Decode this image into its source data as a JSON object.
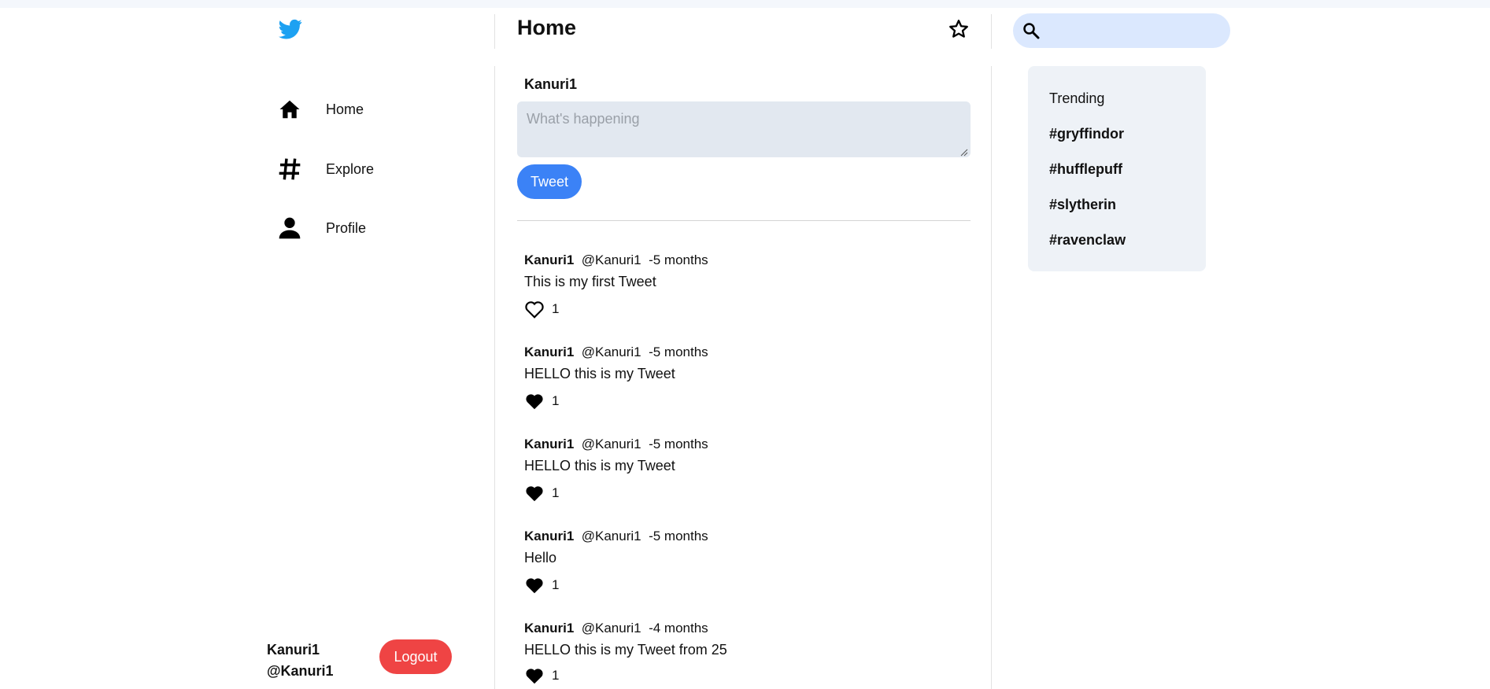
{
  "header": {
    "title": "Home"
  },
  "sidebar": {
    "items": [
      {
        "label": "Home",
        "icon": "home-icon"
      },
      {
        "label": "Explore",
        "icon": "hashtag-icon"
      },
      {
        "label": "Profile",
        "icon": "person-icon"
      }
    ],
    "user": {
      "name": "Kanuri1",
      "handle": "@Kanuri1"
    },
    "logout_label": "Logout"
  },
  "search": {
    "placeholder": "",
    "icon": "search-icon"
  },
  "composer": {
    "user": "Kanuri1",
    "placeholder": "What's happening",
    "button_label": "Tweet"
  },
  "tweets": [
    {
      "name": "Kanuri1",
      "handle": "@Kanuri1",
      "time": "-5 months",
      "text": "This is my first Tweet",
      "likes": "1",
      "liked": false
    },
    {
      "name": "Kanuri1",
      "handle": "@Kanuri1",
      "time": "-5 months",
      "text": "HELLO this is my Tweet",
      "likes": "1",
      "liked": true
    },
    {
      "name": "Kanuri1",
      "handle": "@Kanuri1",
      "time": "-5 months",
      "text": "HELLO this is my Tweet",
      "likes": "1",
      "liked": true
    },
    {
      "name": "Kanuri1",
      "handle": "@Kanuri1",
      "time": "-5 months",
      "text": "Hello",
      "likes": "1",
      "liked": true
    },
    {
      "name": "Kanuri1",
      "handle": "@Kanuri1",
      "time": "-4 months",
      "text": "HELLO this is my Tweet from 25",
      "likes": "1",
      "liked": true
    }
  ],
  "trending": {
    "title": "Trending",
    "tags": [
      "#gryffindor",
      "#hufflepuff",
      "#slytherin",
      "#ravenclaw"
    ]
  },
  "colors": {
    "brand": "#1da1f2",
    "accent": "#3b82f6",
    "danger": "#ef4444",
    "search_bg": "#dbe8fe",
    "panel_bg": "#eef2f7"
  }
}
